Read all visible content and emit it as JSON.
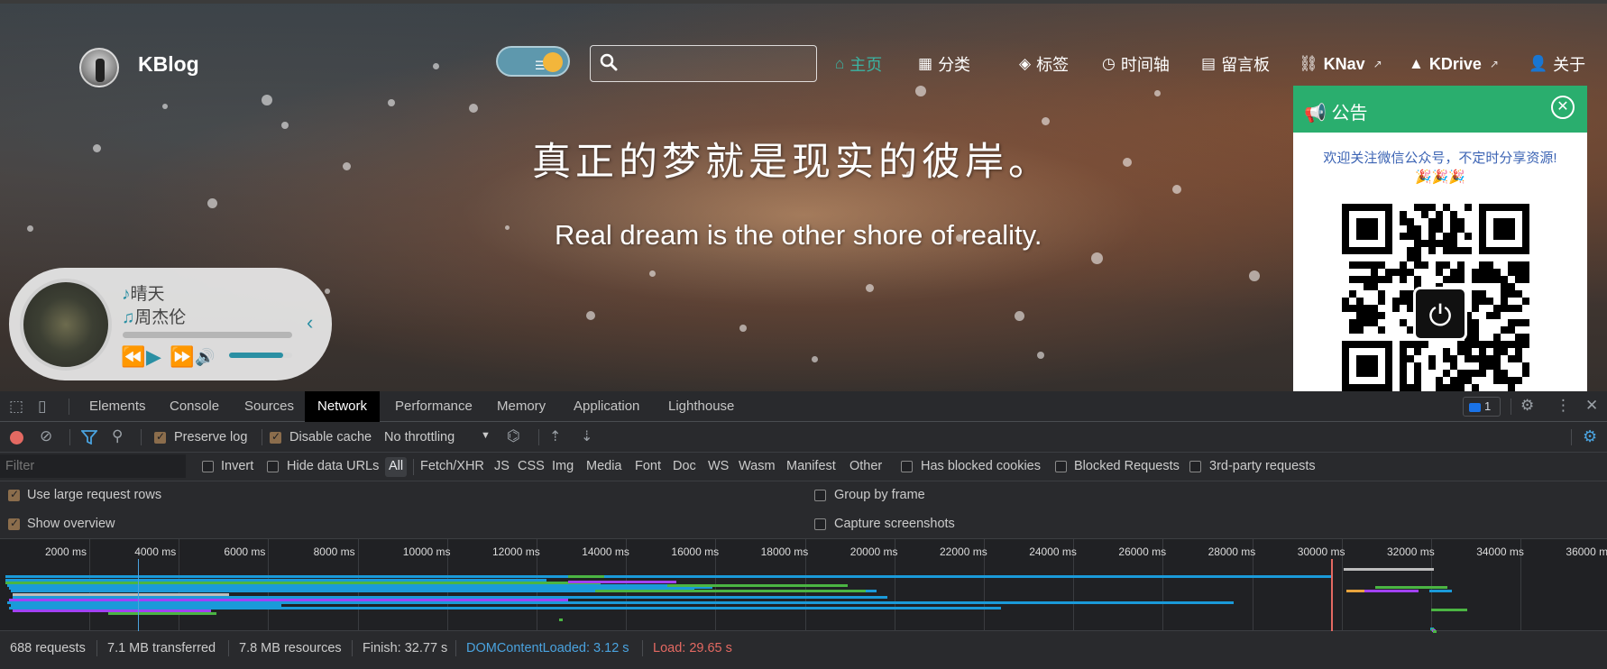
{
  "blog": {
    "site_name": "KBlog",
    "search_placeholder": "",
    "nav": [
      {
        "label": "主页",
        "icon": "home-icon"
      },
      {
        "label": "分类",
        "icon": "grid-icon"
      },
      {
        "label": "标签",
        "icon": "tag-icon"
      },
      {
        "label": "时间轴",
        "icon": "history-icon"
      },
      {
        "label": "留言板",
        "icon": "message-board-icon"
      },
      {
        "label": "KNav",
        "icon": "link-icon"
      },
      {
        "label": "KDrive",
        "icon": "drive-icon"
      },
      {
        "label": "关于",
        "icon": "user-icon"
      }
    ],
    "slogan_cn": "真正的梦就是现实的彼岸。",
    "slogan_en": "Real dream is the other shore of reality.",
    "player": {
      "song": "晴天",
      "singer": "周杰伦",
      "progress": 0,
      "volume": 0.85
    },
    "notice": {
      "title": "公告",
      "message": "欢迎关注微信公众号，不定时分享资源!",
      "emoji": "🎉🎉🎉"
    },
    "colors": {
      "accent": "#3bb4a3",
      "notice_green": "#2aae6e",
      "player_teal": "#2a8fa3"
    }
  },
  "devtools": {
    "tabs": [
      "Elements",
      "Console",
      "Sources",
      "Network",
      "Performance",
      "Memory",
      "Application",
      "Lighthouse"
    ],
    "active_tab": "Network",
    "issues_count": "1",
    "toolbar": {
      "preserve_log": "Preserve log",
      "disable_cache": "Disable cache",
      "throttling": "No throttling"
    },
    "filter_placeholder": "Filter",
    "filters": {
      "invert": "Invert",
      "hide_data_urls": "Hide data URLs",
      "types": [
        "All",
        "Fetch/XHR",
        "JS",
        "CSS",
        "Img",
        "Media",
        "Font",
        "Doc",
        "WS",
        "Wasm",
        "Manifest",
        "Other"
      ],
      "has_blocked_cookies": "Has blocked cookies",
      "blocked_requests": "Blocked Requests",
      "third_party": "3rd-party requests"
    },
    "options": {
      "large_rows": "Use large request rows",
      "show_overview": "Show overview",
      "group_by_frame": "Group by frame",
      "capture_screenshots": "Capture screenshots"
    },
    "timeline_ticks": [
      "2000 ms",
      "4000 ms",
      "6000 ms",
      "8000 ms",
      "10000 ms",
      "12000 ms",
      "14000 ms",
      "16000 ms",
      "18000 ms",
      "20000 ms",
      "22000 ms",
      "24000 ms",
      "26000 ms",
      "28000 ms",
      "30000 ms",
      "32000 ms",
      "34000 ms",
      "36000 m"
    ],
    "status": {
      "requests": "688 requests",
      "transferred": "7.1 MB transferred",
      "resources": "7.8 MB resources",
      "finish": "Finish: 32.77 s",
      "dom_loaded": "DOMContentLoaded: 3.12 s",
      "load": "Load: 29.65 s"
    },
    "colors": {
      "dom_loaded": "#4aa3df",
      "load": "#e46962",
      "request_bar": "#1a9ad9"
    }
  }
}
